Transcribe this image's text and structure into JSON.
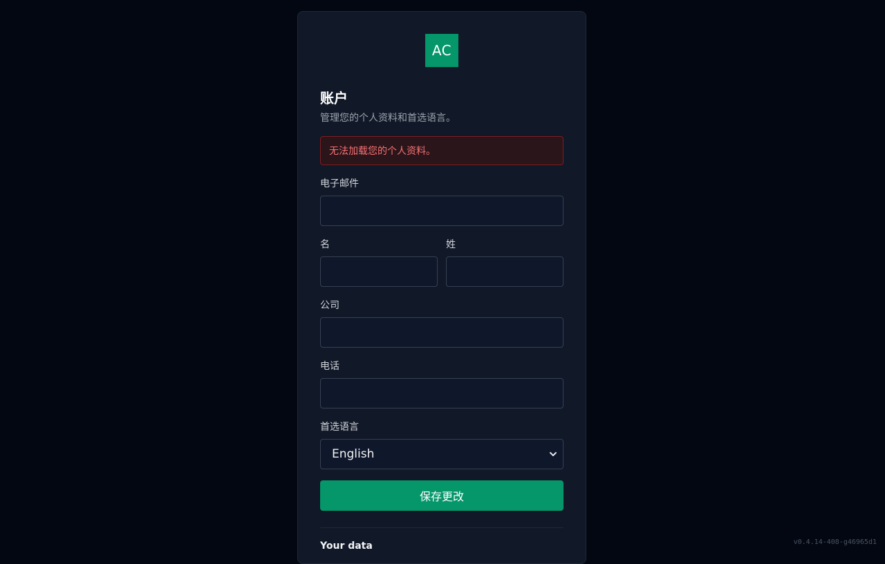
{
  "logo": {
    "text": "AC"
  },
  "header": {
    "title": "账户",
    "subtitle": "管理您的个人资料和首选语言。"
  },
  "error": {
    "message": "无法加载您的个人资料。"
  },
  "form": {
    "email": {
      "label": "电子邮件",
      "value": "",
      "placeholder": ""
    },
    "first_name": {
      "label": "名",
      "value": "",
      "placeholder": ""
    },
    "last_name": {
      "label": "姓",
      "value": "",
      "placeholder": ""
    },
    "company": {
      "label": "公司",
      "value": "",
      "placeholder": ""
    },
    "phone": {
      "label": "电话",
      "value": "",
      "placeholder": ""
    },
    "language": {
      "label": "首选语言",
      "selected": "English"
    },
    "save_label": "保存更改"
  },
  "data_section": {
    "title": "Your data"
  },
  "footer": {
    "version": "v0.4.14-408-g46965d1"
  },
  "colors": {
    "accent": "#059669",
    "background": "#030712",
    "card": "#111827",
    "error_text": "#f87171",
    "error_border": "#7f1d1d"
  },
  "icons": {
    "select_arrow": "chevron-down-icon"
  }
}
